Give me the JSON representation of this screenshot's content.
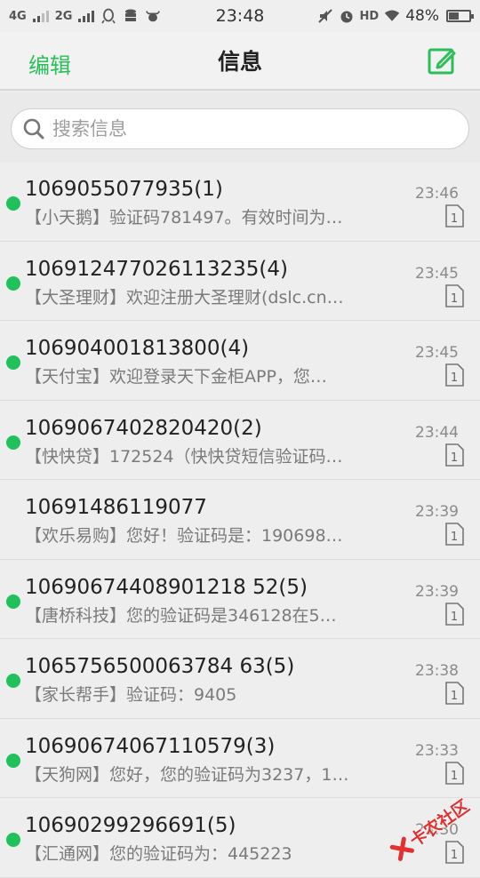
{
  "status_bar": {
    "net1": "4G",
    "net2": "2G",
    "time": "23:48",
    "hd": "HD",
    "battery": "48%",
    "battery_level": 0.48
  },
  "header": {
    "edit_label": "编辑",
    "title": "信息"
  },
  "search": {
    "placeholder": "搜索信息"
  },
  "messages": [
    {
      "sender": "1069055077935(1)",
      "preview": "【小天鹅】验证码781497。有效时间为…",
      "time": "23:46",
      "sim": "1",
      "unread": true
    },
    {
      "sender": "106912477026113235(4)",
      "preview": "【大圣理财】欢迎注册大圣理财(dslc.cn…",
      "time": "23:45",
      "sim": "1",
      "unread": true
    },
    {
      "sender": "106904001813800(4)",
      "preview": "【天付宝】欢迎登录天下金柜APP，您…",
      "time": "23:45",
      "sim": "1",
      "unread": true
    },
    {
      "sender": "1069067402820420(2)",
      "preview": "【快快贷】172524（快快贷短信验证码…",
      "time": "23:44",
      "sim": "1",
      "unread": true
    },
    {
      "sender": "10691486119077",
      "preview": "【欢乐易购】您好！验证码是：190698…",
      "time": "23:39",
      "sim": "1",
      "unread": false
    },
    {
      "sender": "10690674408901218 52(5)",
      "preview": "【唐桥科技】您的验证码是346128在5…",
      "time": "23:39",
      "sim": "1",
      "unread": true
    },
    {
      "sender": "1065756500063784 63(5)",
      "preview": "【家长帮手】验证码：9405",
      "time": "23:38",
      "sim": "1",
      "unread": true
    },
    {
      "sender": "10690674067110579(3)",
      "preview": "【天狗网】您好，您的验证码为3237，1…",
      "time": "23:33",
      "sim": "1",
      "unread": true
    },
    {
      "sender": "10690299296691(5)",
      "preview": "【汇通网】您的验证码为：445223",
      "time": "23:30",
      "sim": "1",
      "unread": true
    }
  ],
  "watermark": {
    "text": "卡农社区"
  },
  "colors": {
    "accent": "#2bbf5a",
    "unread_dot": "#1fc25a"
  }
}
